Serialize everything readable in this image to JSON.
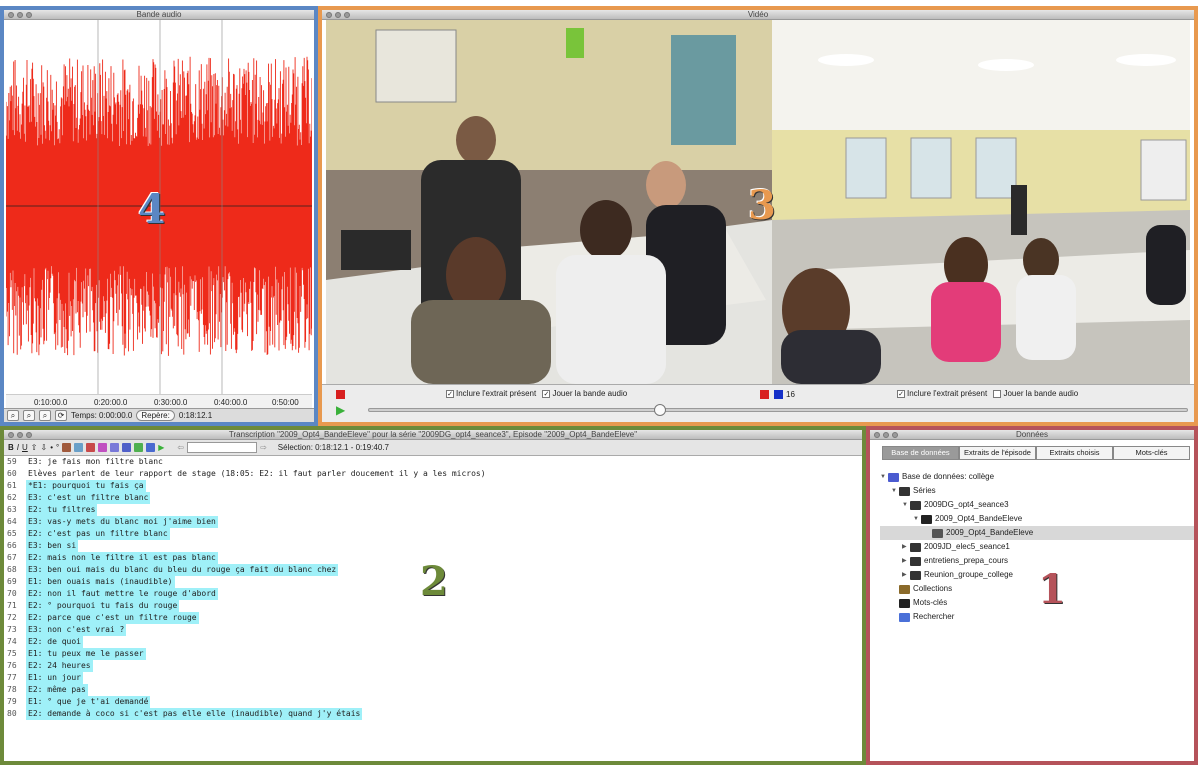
{
  "audio": {
    "title": "Bande audio",
    "overlay_number": "4",
    "ticks": [
      "0:10:00.0",
      "0:20:00.0",
      "0:30:00.0",
      "0:40:00.0",
      "0:50:00"
    ],
    "time_label": "Temps: 0:00:00.0",
    "repere_label": "Repère:",
    "repere_value": "0:18:12.1",
    "wave_color": "#ee2a1a"
  },
  "video": {
    "title": "Vidéo",
    "overlay_number": "3",
    "left": {
      "include_label": "Inclure l'extrait présent",
      "include_checked": true,
      "play_label": "Jouer la bande audio",
      "play_checked": true,
      "color": "#d82020"
    },
    "right": {
      "include_label": "Inclure l'extrait présent",
      "include_checked": true,
      "play_label": "Jouer la bande audio",
      "play_checked": false,
      "colors": [
        "#d82020",
        "#1530c8"
      ],
      "count": "16"
    }
  },
  "transcription": {
    "title": "Transcription \"2009_Opt4_BandeEleve\" pour la série \"2009DG_opt4_seance3\", Episode \"2009_Opt4_BandeEleve\"",
    "selection_label": "Sélection: 0:18:12.1 - 0:19:40.7",
    "overlay_number": "2",
    "highlight_color": "#9ff0f8",
    "lines": [
      {
        "n": "59",
        "text": "E3: je fais mon filtre blanc",
        "hl": false
      },
      {
        "n": "60",
        "text": "Elèves parlent de leur rapport de stage (18:05: E2: il faut parler doucement il y a les micros)",
        "hl": false
      },
      {
        "n": "61",
        "text": "*E1: pourquoi tu fais ça",
        "hl": true
      },
      {
        "n": "62",
        "text": "E3: c'est un filtre blanc",
        "hl": true
      },
      {
        "n": "63",
        "text": "E2: tu filtres",
        "hl": true
      },
      {
        "n": "64",
        "text": "E3: vas-y mets du blanc moi j'aime bien",
        "hl": true
      },
      {
        "n": "65",
        "text": "E2: c'est pas un filtre blanc",
        "hl": true
      },
      {
        "n": "66",
        "text": "E3: ben si",
        "hl": true
      },
      {
        "n": "67",
        "text": "E2: mais non le filtre il est pas blanc",
        "hl": true
      },
      {
        "n": "68",
        "text": "E3: ben oui mais du blanc du bleu du rouge ça fait du blanc chez",
        "hl": true
      },
      {
        "n": "69",
        "text": "E1: ben ouais mais (inaudible)",
        "hl": true
      },
      {
        "n": "70",
        "text": "E2: non il faut mettre le rouge d'abord",
        "hl": true
      },
      {
        "n": "71",
        "text": "E2: ° pourquoi tu fais du rouge",
        "hl": true
      },
      {
        "n": "72",
        "text": "E2: parce que c'est un filtre rouge",
        "hl": true
      },
      {
        "n": "73",
        "text": "E3: non c'est vrai ?",
        "hl": true
      },
      {
        "n": "74",
        "text": "E2: de quoi",
        "hl": true
      },
      {
        "n": "75",
        "text": "E1: tu peux me le passer",
        "hl": true
      },
      {
        "n": "76",
        "text": "E2: 24 heures",
        "hl": true
      },
      {
        "n": "77",
        "text": "E1: un jour",
        "hl": true
      },
      {
        "n": "78",
        "text": "E2: même pas",
        "hl": true
      },
      {
        "n": "79",
        "text": "E1: ° que je t'ai demandé",
        "hl": true
      },
      {
        "n": "80",
        "text": "E2: demande à coco si c'est pas elle elle (inaudible) quand j'y étais",
        "hl": true
      }
    ]
  },
  "data": {
    "title": "Données",
    "overlay_number": "1",
    "tabs": [
      "Base de données",
      "Extraits de l'épisode",
      "Extraits choisis",
      "Mots-clés"
    ],
    "tree": [
      {
        "label": "Base de données: collège",
        "depth": 0,
        "tri": "▼",
        "icon": "database-icon",
        "sel": false
      },
      {
        "label": "Séries",
        "depth": 1,
        "tri": "▼",
        "icon": "series-icon",
        "sel": false
      },
      {
        "label": "2009DG_opt4_seance3",
        "depth": 2,
        "tri": "▼",
        "icon": "series-icon",
        "sel": false
      },
      {
        "label": "2009_Opt4_BandeEleve",
        "depth": 3,
        "tri": "▼",
        "icon": "episode-icon",
        "sel": false
      },
      {
        "label": "2009_Opt4_BandeEleve",
        "depth": 4,
        "tri": "",
        "icon": "transcript-icon",
        "sel": true
      },
      {
        "label": "2009JD_elec5_seance1",
        "depth": 2,
        "tri": "▶",
        "icon": "series-icon",
        "sel": false
      },
      {
        "label": "entretiens_prepa_cours",
        "depth": 2,
        "tri": "▶",
        "icon": "series-icon",
        "sel": false
      },
      {
        "label": "Reunion_groupe_college",
        "depth": 2,
        "tri": "▶",
        "icon": "series-icon",
        "sel": false
      },
      {
        "label": "Collections",
        "depth": 1,
        "tri": "",
        "icon": "collections-icon",
        "sel": false
      },
      {
        "label": "Mots-clés",
        "depth": 1,
        "tri": "",
        "icon": "keywords-icon",
        "sel": false
      },
      {
        "label": "Rechercher",
        "depth": 1,
        "tri": "",
        "icon": "search-icon",
        "sel": false
      }
    ]
  },
  "colors": {
    "audio_frame": "#5b87c4",
    "video_frame": "#e8994f",
    "transcription_frame": "#6d8a3a",
    "data_frame": "#b5535a"
  }
}
